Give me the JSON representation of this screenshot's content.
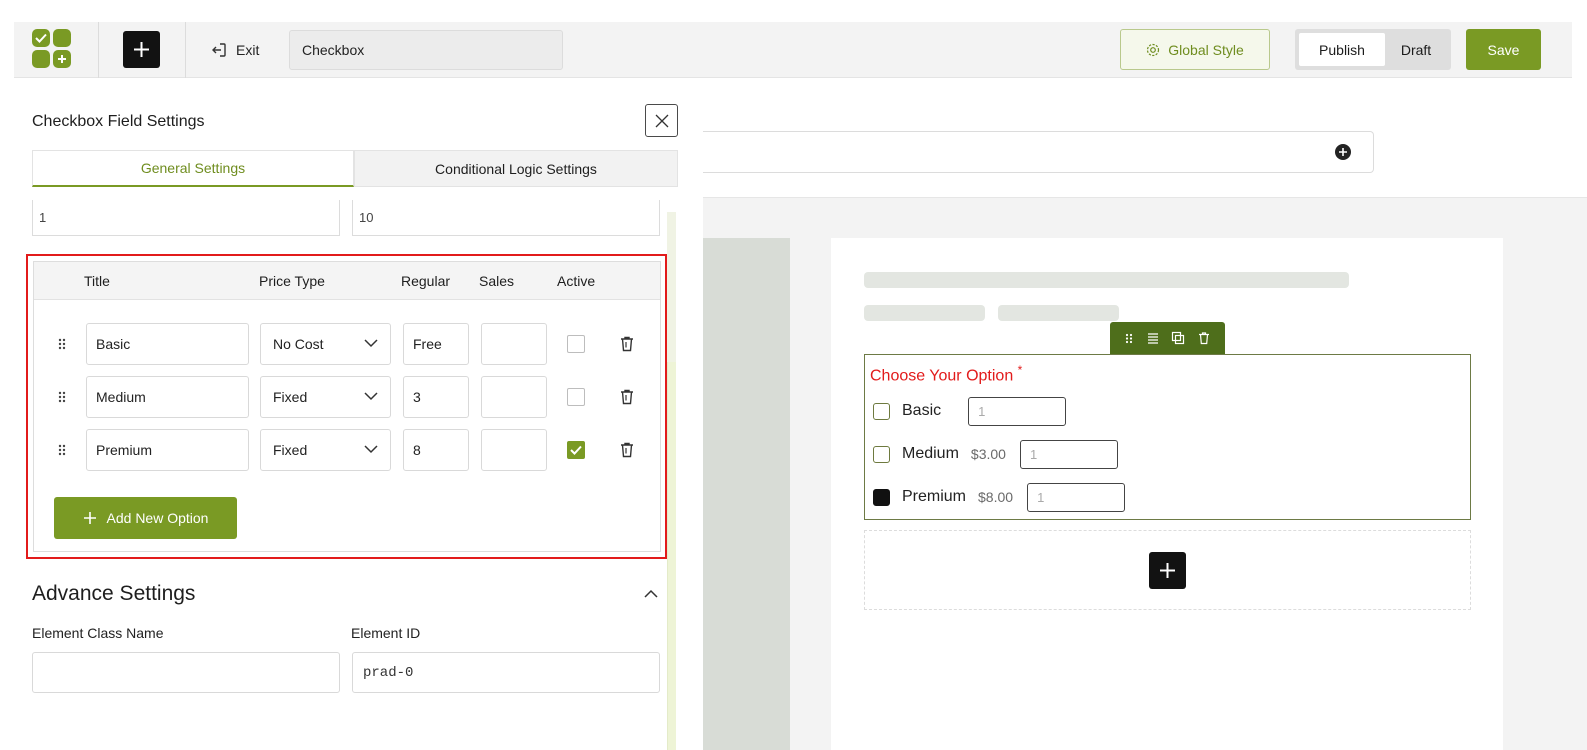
{
  "topbar": {
    "exit_label": "Exit",
    "form_title_value": "Checkbox",
    "global_style_label": "Global Style",
    "publish_label": "Publish",
    "draft_label": "Draft",
    "save_label": "Save"
  },
  "panel": {
    "title": "Checkbox Field Settings",
    "tabs": [
      {
        "label": "General Settings",
        "active": true
      },
      {
        "label": "Conditional Logic Settings",
        "active": false
      }
    ],
    "min_value": "1",
    "max_value": "10",
    "options_table": {
      "headers": {
        "title": "Title",
        "price_type": "Price Type",
        "regular": "Regular",
        "sales": "Sales",
        "active": "Active"
      },
      "rows": [
        {
          "title": "Basic",
          "price_type": "No Cost",
          "regular": "Free",
          "sales": "",
          "active": false
        },
        {
          "title": "Medium",
          "price_type": "Fixed",
          "regular": "3",
          "sales": "",
          "active": false
        },
        {
          "title": "Premium",
          "price_type": "Fixed",
          "regular": "8",
          "sales": "",
          "active": true
        }
      ],
      "add_option_label": "Add New Option"
    },
    "advance": {
      "title": "Advance Settings",
      "class_label": "Element Class Name",
      "class_value": "",
      "id_label": "Element ID",
      "id_value": "prad-0"
    }
  },
  "preview": {
    "field_label": "Choose Your Option",
    "required_mark": "*",
    "options": [
      {
        "label": "Basic",
        "price": "",
        "qty": "1",
        "checked": false
      },
      {
        "label": "Medium",
        "price": "$3.00",
        "qty": "1",
        "checked": false
      },
      {
        "label": "Premium",
        "price": "$8.00",
        "qty": "1",
        "checked": true
      }
    ]
  },
  "colors": {
    "accent": "#7a9a24",
    "highlight_border": "#e21b1b",
    "dark": "#121212"
  }
}
